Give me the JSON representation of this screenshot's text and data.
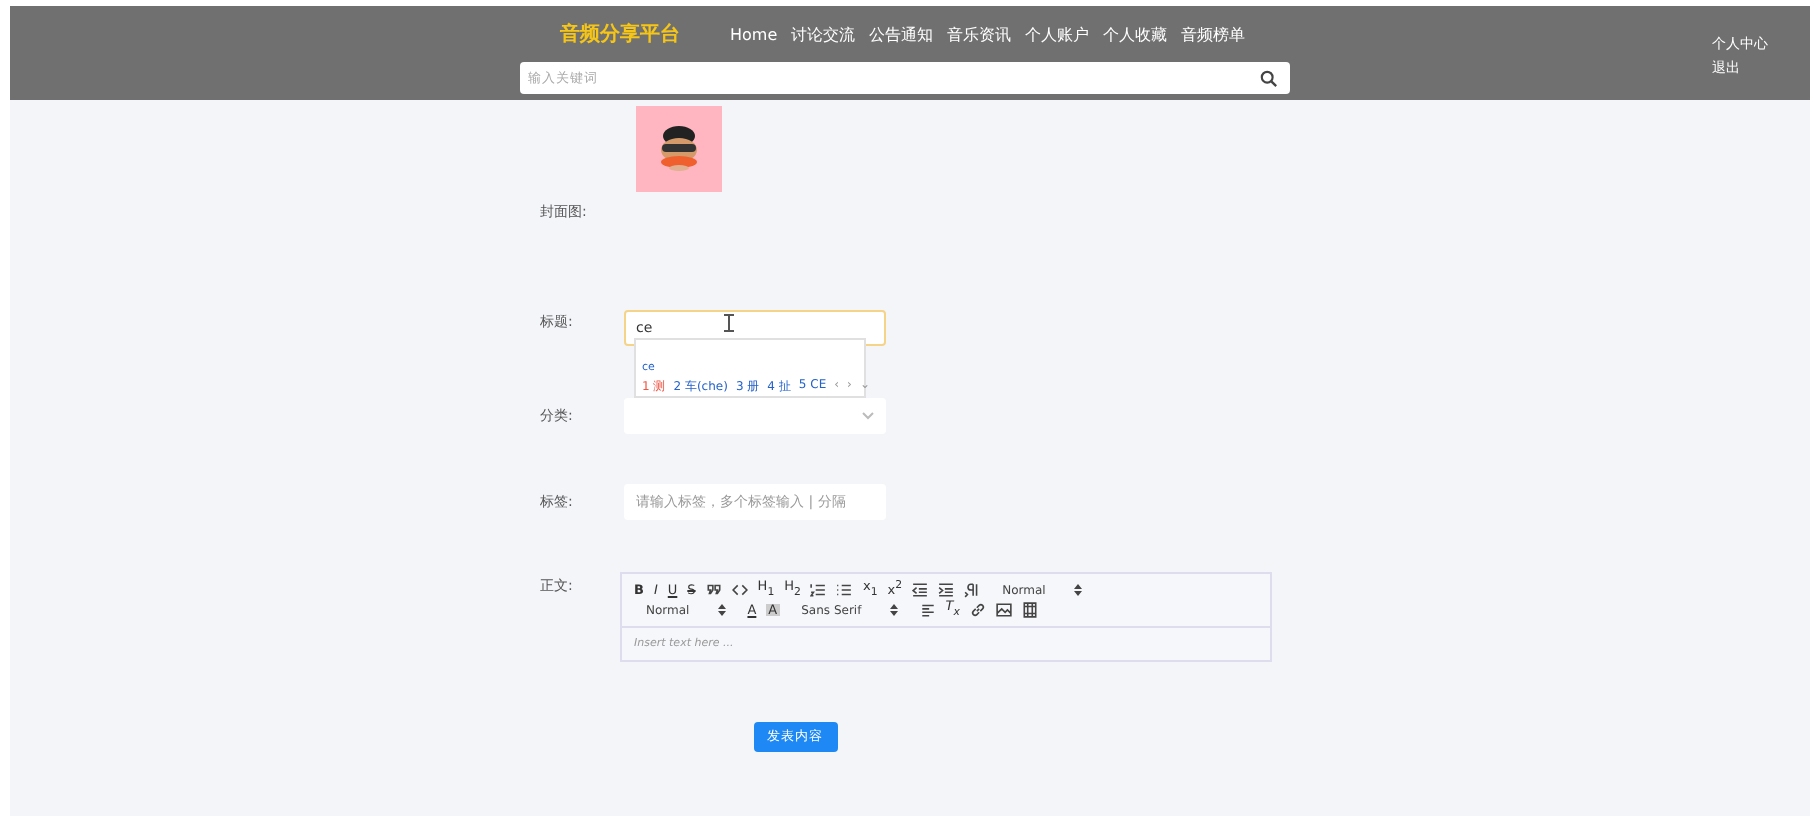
{
  "header": {
    "logo": "音频分享平台",
    "nav": [
      "Home",
      "讨论交流",
      "公告通知",
      "音乐资讯",
      "个人账户",
      "个人收藏",
      "音频榜单"
    ],
    "search": {
      "placeholder": "输入关键词"
    },
    "user_links": [
      "个人中心",
      "退出"
    ]
  },
  "form": {
    "cover": {
      "label": "封面图:"
    },
    "title": {
      "label": "标题:",
      "value": "ce",
      "ime": {
        "composition": "ce",
        "candidates": [
          "1 测",
          "2 车(che)",
          "3 册",
          "4 扯",
          "5 CE"
        ],
        "arrows": [
          "‹",
          "›",
          "⌄"
        ]
      }
    },
    "category": {
      "label": "分类:"
    },
    "tags": {
      "label": "标签:",
      "placeholder": "请输入标签，多个标签输入 | 分隔"
    },
    "content": {
      "label": "正文:",
      "placeholder": "Insert text here ...",
      "toolbar": [
        [
          {
            "kind": "bold",
            "label": "B"
          },
          {
            "kind": "italic",
            "label": "I"
          },
          {
            "kind": "underline",
            "label": "U"
          },
          {
            "kind": "strike",
            "label": "S"
          },
          {
            "kind": "icon"
          },
          {
            "kind": "icon"
          },
          {
            "kind": "glyph",
            "label": "H$_{1}$"
          },
          {
            "kind": "glyph",
            "label": "H$_{2}$"
          },
          {
            "kind": "icon"
          },
          {
            "kind": "icon"
          },
          {
            "kind": "glyph",
            "label": "x$_{1}$"
          },
          {
            "kind": "glyph",
            "label": "x$^{2}$"
          },
          {
            "kind": "icon"
          },
          {
            "kind": "icon"
          },
          {
            "kind": "icon"
          },
          {
            "kind": "select",
            "label": "Normal"
          }
        ],
        [
          {
            "kind": "select",
            "label": "Normal"
          },
          {
            "kind": "underline",
            "label": "A"
          },
          {
            "kind": "boxed",
            "label": "A"
          },
          {
            "kind": "select",
            "label": "Sans Serif"
          },
          {
            "kind": "icon"
          },
          {
            "kind": "italic",
            "label": "T$_{x}$"
          },
          {
            "kind": "icon"
          },
          {
            "kind": "icon"
          },
          {
            "kind": "icon"
          }
        ]
      ]
    },
    "submit": "发表内容"
  }
}
